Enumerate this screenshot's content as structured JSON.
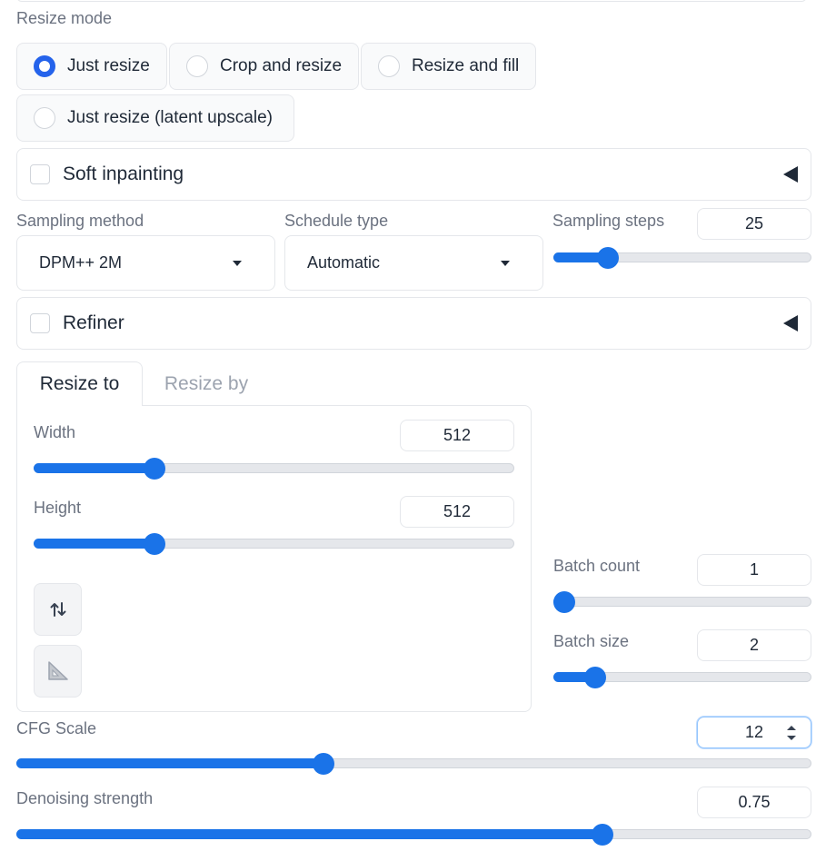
{
  "resize_mode": {
    "label": "Resize mode",
    "options": [
      {
        "label": "Just resize",
        "checked": true
      },
      {
        "label": "Crop and resize",
        "checked": false
      },
      {
        "label": "Resize and fill",
        "checked": false
      },
      {
        "label": "Just resize (latent upscale)",
        "checked": false
      }
    ]
  },
  "soft_inpainting": {
    "label": "Soft inpainting",
    "checked": false
  },
  "sampling_method": {
    "label": "Sampling method",
    "value": "DPM++ 2M"
  },
  "schedule_type": {
    "label": "Schedule type",
    "value": "Automatic"
  },
  "sampling_steps": {
    "label": "Sampling steps",
    "value": "25",
    "fraction": 0.186
  },
  "refiner": {
    "label": "Refiner",
    "checked": false
  },
  "tabs": [
    {
      "label": "Resize to",
      "active": true
    },
    {
      "label": "Resize by",
      "active": false
    }
  ],
  "width": {
    "label": "Width",
    "value": "512",
    "fraction": 0.24
  },
  "height": {
    "label": "Height",
    "value": "512",
    "fraction": 0.24
  },
  "batch_count": {
    "label": "Batch count",
    "value": "1",
    "fraction": 0.0
  },
  "batch_size": {
    "label": "Batch size",
    "value": "2",
    "fraction": 0.13
  },
  "cfg_scale": {
    "label": "CFG Scale",
    "value": "12",
    "fraction": 0.383
  },
  "denoising_strength": {
    "label": "Denoising strength",
    "value": "0.75",
    "fraction": 0.744
  },
  "colors": {
    "accent": "#1a73e8",
    "radio_checked": "#2563eb",
    "border": "#e5e7eb",
    "label": "#6b7280"
  },
  "icons": {
    "swap": "swap-dimensions-icon",
    "aspect": "triangle-ruler-icon",
    "collapse": "triangle-left-icon",
    "caret": "chevron-down-icon"
  }
}
